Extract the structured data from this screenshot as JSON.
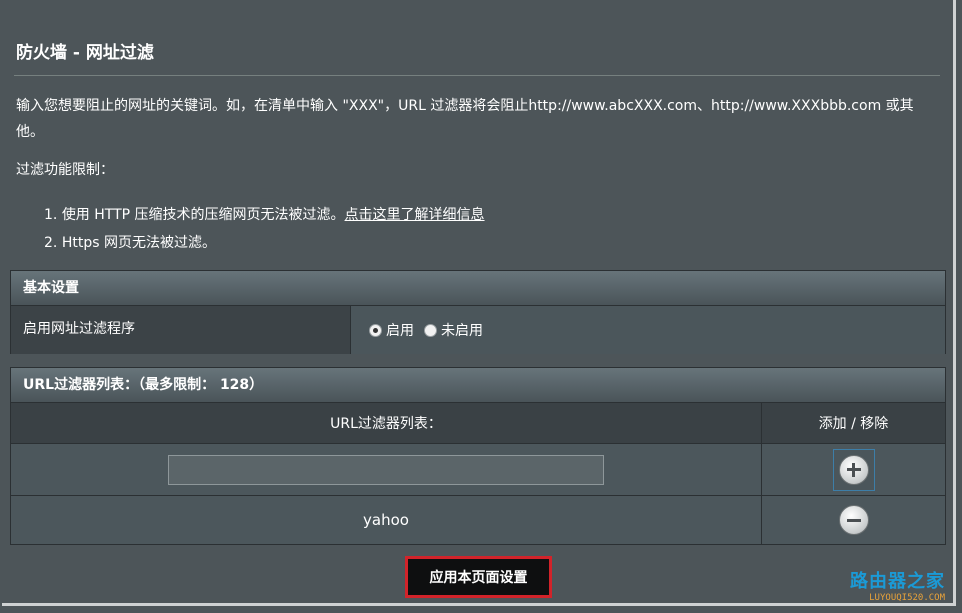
{
  "page": {
    "title": "防火墙 - 网址过滤",
    "intro": "输入您想要阻止的网址的关键词。如，在清单中输入 \"XXX\"，URL 过滤器将会阻止http://www.abcXXX.com、http://www.XXXbbb.com 或其他。",
    "limit_title": "过滤功能限制：",
    "limits": [
      {
        "num": "1.",
        "text": "使用 HTTP 压缩技术的压缩网页无法被过滤。",
        "link": "点击这里了解详细信息"
      },
      {
        "num": "2.",
        "text": "Https 网页无法被过滤。"
      }
    ]
  },
  "basic": {
    "header": "基本设置",
    "label": "启用网址过滤程序",
    "options": [
      "启用",
      "未启用"
    ],
    "selected": "启用"
  },
  "url_list": {
    "header": "URL过滤器列表：（最多限制： 128）",
    "col_main": "URL过滤器列表：",
    "col_action": "添加 / 移除",
    "input_value": "",
    "items": [
      "yahoo"
    ],
    "add_icon": "plus-circle-icon",
    "remove_icon": "minus-circle-icon"
  },
  "apply_button": "应用本页面设置",
  "watermark": {
    "main": "路由器之家",
    "sub": "LUYOUQI520.COM"
  }
}
